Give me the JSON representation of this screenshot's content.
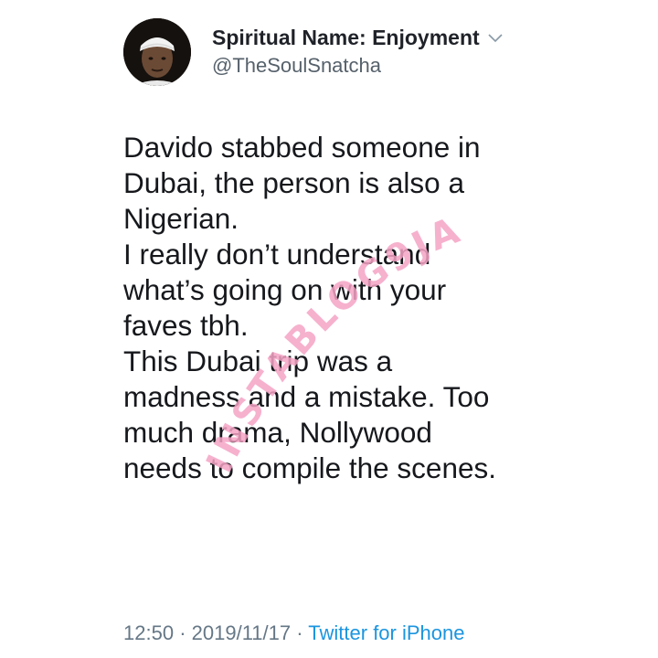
{
  "profile": {
    "display_name": "Spiritual Name: Enjoyment",
    "handle": "@TheSoulSnatcha",
    "avatar_icon": "profile-photo"
  },
  "tweet": {
    "lines": [
      "Davido stabbed someone in",
      "Dubai, the person is also a",
      "Nigerian.",
      "I really don’t understand",
      "what’s going on with your",
      "faves tbh.",
      "This Dubai trip was a",
      "madness and a mistake. Too",
      "much drama, Nollywood",
      "needs to compile the scenes."
    ]
  },
  "meta": {
    "time": "12:50",
    "separator": "·",
    "date": "2019/11/17",
    "source": "Twitter for iPhone"
  },
  "watermark": {
    "text": "INSTABLOG9JA",
    "color": "#f4a3c4"
  },
  "colors": {
    "name": "#1f2228",
    "handle": "#56616b",
    "body": "#16181c",
    "meta": "#657786",
    "link": "#1b95e0"
  }
}
